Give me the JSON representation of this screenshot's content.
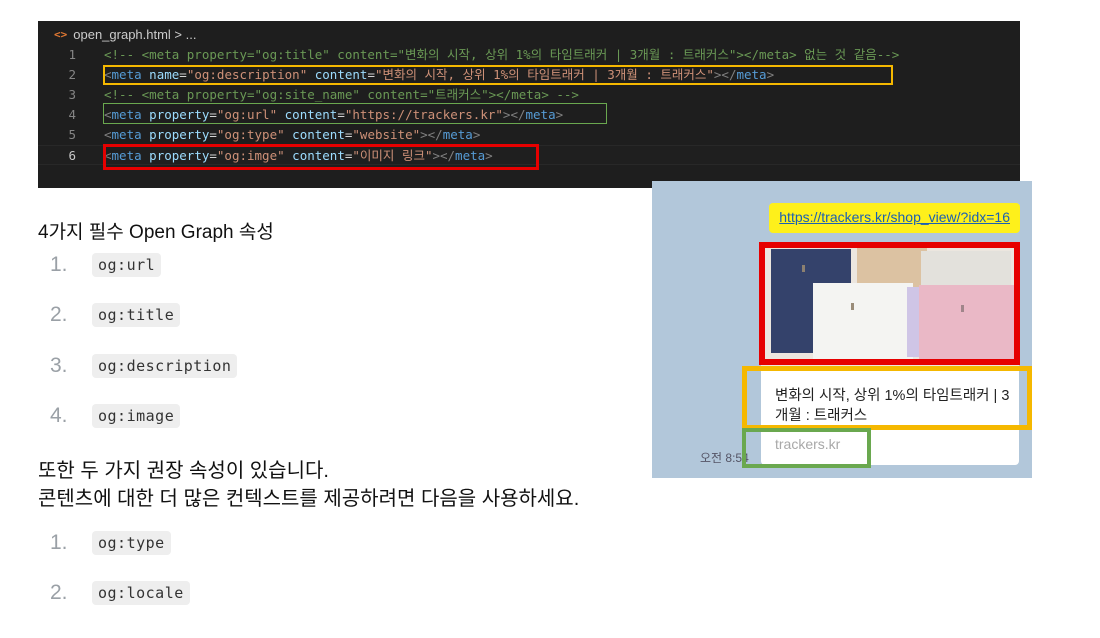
{
  "editor": {
    "breadcrumb": "open_graph.html > ...",
    "file_icon": "<>",
    "lines": [
      {
        "num": "1",
        "parts": [
          {
            "t": "<!-- <meta property=\"og:title\" content=\"변화의 시작, 상위 1%의 타임트래커 | 3개월 : 트래커스\"></meta>  없는 것 같음-->",
            "c": "c-com"
          }
        ]
      },
      {
        "num": "2",
        "parts": [
          {
            "t": "<",
            "c": "c-punc"
          },
          {
            "t": "meta",
            "c": "c-tag"
          },
          {
            "t": " name",
            "c": "c-attr"
          },
          {
            "t": "=",
            "c": "c-txt"
          },
          {
            "t": "\"og:description\"",
            "c": "c-str"
          },
          {
            "t": " content",
            "c": "c-attr"
          },
          {
            "t": "=",
            "c": "c-txt"
          },
          {
            "t": "\"변화의 시작, 상위 1%의 타임트래커 | 3개월 : 트래커스\"",
            "c": "c-str"
          },
          {
            "t": "></",
            "c": "c-punc"
          },
          {
            "t": "meta",
            "c": "c-tag"
          },
          {
            "t": ">",
            "c": "c-punc"
          }
        ]
      },
      {
        "num": "3",
        "parts": [
          {
            "t": "<!-- <meta property=\"og:site_name\" content=\"트래커스\"></meta> -->",
            "c": "c-com"
          }
        ]
      },
      {
        "num": "4",
        "parts": [
          {
            "t": "<",
            "c": "c-punc"
          },
          {
            "t": "meta",
            "c": "c-tag"
          },
          {
            "t": " property",
            "c": "c-attr"
          },
          {
            "t": "=",
            "c": "c-txt"
          },
          {
            "t": "\"og:url\"",
            "c": "c-str"
          },
          {
            "t": " content",
            "c": "c-attr"
          },
          {
            "t": "=",
            "c": "c-txt"
          },
          {
            "t": "\"https://trackers.kr\"",
            "c": "c-str"
          },
          {
            "t": "></",
            "c": "c-punc"
          },
          {
            "t": "meta",
            "c": "c-tag"
          },
          {
            "t": ">",
            "c": "c-punc"
          }
        ]
      },
      {
        "num": "5",
        "parts": [
          {
            "t": "<",
            "c": "c-punc"
          },
          {
            "t": "meta",
            "c": "c-tag"
          },
          {
            "t": " property",
            "c": "c-attr"
          },
          {
            "t": "=",
            "c": "c-txt"
          },
          {
            "t": "\"og:type\"",
            "c": "c-str"
          },
          {
            "t": " content",
            "c": "c-attr"
          },
          {
            "t": "=",
            "c": "c-txt"
          },
          {
            "t": "\"website\"",
            "c": "c-str"
          },
          {
            "t": "></",
            "c": "c-punc"
          },
          {
            "t": "meta",
            "c": "c-tag"
          },
          {
            "t": ">",
            "c": "c-punc"
          }
        ]
      },
      {
        "num": "6",
        "parts": [
          {
            "t": "<",
            "c": "c-punc"
          },
          {
            "t": "meta",
            "c": "c-tag"
          },
          {
            "t": " property",
            "c": "c-attr"
          },
          {
            "t": "=",
            "c": "c-txt"
          },
          {
            "t": "\"og:imge\"",
            "c": "c-str"
          },
          {
            "t": " content",
            "c": "c-attr"
          },
          {
            "t": "=",
            "c": "c-txt"
          },
          {
            "t": "\"이미지 링크\"",
            "c": "c-str"
          },
          {
            "t": "></",
            "c": "c-punc"
          },
          {
            "t": "meta",
            "c": "c-tag"
          },
          {
            "t": ">",
            "c": "c-punc"
          }
        ]
      }
    ]
  },
  "required": {
    "heading": "4가지 필수 Open Graph 속성",
    "items": [
      {
        "num": "1.",
        "code": "og:url"
      },
      {
        "num": "2.",
        "code": "og:title"
      },
      {
        "num": "3.",
        "code": "og:description"
      },
      {
        "num": "4.",
        "code": "og:image"
      }
    ]
  },
  "recommended": {
    "line1": "또한 두 가지 권장 속성이 있습니다.",
    "line2": "콘텐츠에 대한 더 많은 컨텍스트를 제공하려면 다음을 사용하세요.",
    "items": [
      {
        "num": "1.",
        "code": "og:type"
      },
      {
        "num": "2.",
        "code": "og:locale"
      }
    ]
  },
  "chat": {
    "link_text": "https://trackers.kr/shop_view/?idx=16",
    "description": "변화의 시작, 상위 1%의 타임트래커 | 3개월 : 트래커스",
    "domain": "trackers.kr",
    "time": "오전 8:54"
  },
  "colors": {
    "highlight_red": "#e60000",
    "highlight_yellow": "#f5b800",
    "highlight_green": "#6aa84f",
    "editor_bg": "#1e1e1e",
    "chat_bg": "#b2c7da",
    "bubble_yellow": "#fef01b"
  }
}
